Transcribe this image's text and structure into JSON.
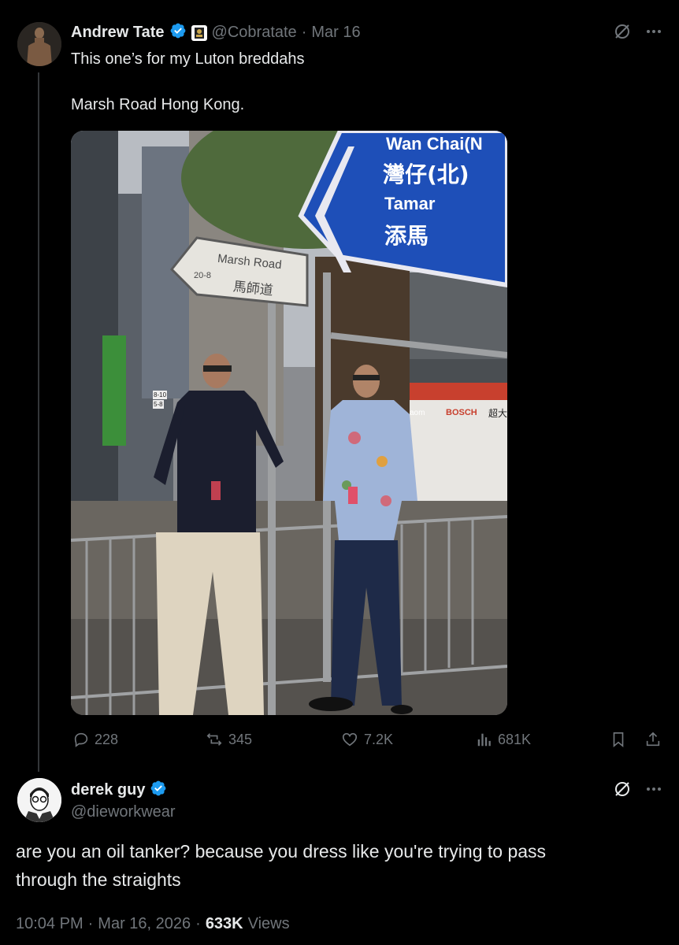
{
  "tweet1": {
    "author_name": "Andrew Tate",
    "handle": "@Cobratate",
    "separator": "·",
    "date": "Mar 16",
    "text_line1": "This one’s for my Luton breddahs",
    "text_line2": "Marsh Road Hong Kong.",
    "photo": {
      "sign_main_line1": "Wan Chai(N",
      "sign_main_line2": "灣仔(北)",
      "sign_main_line3": "Tamar",
      "sign_main_line4": "添馬",
      "sign_street_en": "Marsh Road",
      "sign_street_num": "20-8",
      "sign_street_zh": "馬師道",
      "bus_ad": "BOSCH",
      "bus_ad2": "超大",
      "small_sign_1": "8-10",
      "small_sign_2": "5-8",
      "brand_partial": "aom"
    },
    "metrics": {
      "replies": "228",
      "reposts": "345",
      "likes": "7.2K",
      "views": "681K"
    }
  },
  "tweet2": {
    "author_name": "derek guy",
    "handle": "@dieworkwear",
    "text_line1": "are you an oil tanker? because you dress like you're trying to pass",
    "text_line2": "through the straights",
    "time": "10:04 PM",
    "separator": "·",
    "date": "Mar 16, 2026",
    "views_count": "633K",
    "views_label": "Views"
  },
  "colors": {
    "background": "#000000",
    "text": "#e7e9ea",
    "muted": "#71767b",
    "verified": "#1d9bf0",
    "sign_blue": "#1e4fb8"
  }
}
